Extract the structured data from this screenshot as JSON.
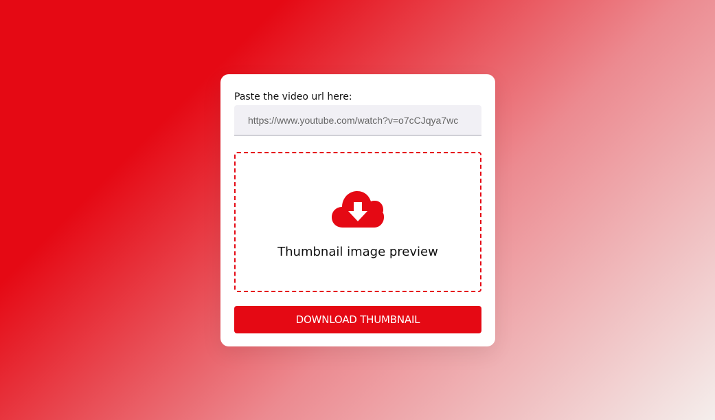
{
  "form": {
    "url_label": "Paste the video url here:",
    "url_placeholder": "https://www.youtube.com/watch?v=o7cCJqya7wc",
    "url_value": ""
  },
  "preview": {
    "icon": "cloud-download-icon",
    "text": "Thumbnail image preview"
  },
  "actions": {
    "download_label": "DOWNLOAD THUMBNAIL"
  },
  "colors": {
    "accent": "#e50914",
    "card": "#ffffff",
    "input_bg": "#f1f0f5"
  }
}
